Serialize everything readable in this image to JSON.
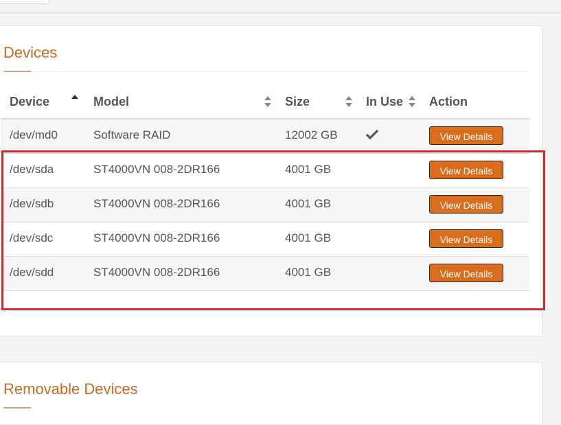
{
  "devices_panel": {
    "title": "Devices",
    "columns": {
      "device": "Device",
      "model": "Model",
      "size": "Size",
      "in_use": "In Use",
      "action": "Action"
    },
    "rows": [
      {
        "device": "/dev/md0",
        "model": "Software RAID",
        "size": "12002 GB",
        "in_use": true,
        "action": "View Details"
      },
      {
        "device": "/dev/sda",
        "model": "ST4000VN 008-2DR166",
        "size": "4001 GB",
        "in_use": false,
        "action": "View Details"
      },
      {
        "device": "/dev/sdb",
        "model": "ST4000VN 008-2DR166",
        "size": "4001 GB",
        "in_use": false,
        "action": "View Details"
      },
      {
        "device": "/dev/sdc",
        "model": "ST4000VN 008-2DR166",
        "size": "4001 GB",
        "in_use": false,
        "action": "View Details"
      },
      {
        "device": "/dev/sdd",
        "model": "ST4000VN 008-2DR166",
        "size": "4001 GB",
        "in_use": false,
        "action": "View Details"
      }
    ]
  },
  "removable_panel": {
    "title": "Removable Devices"
  },
  "colors": {
    "accent": "#c96a22",
    "button": "#d96d1e",
    "highlight": "#d12b2b"
  },
  "icons": {
    "sort_asc": "caret-up-icon",
    "sort_both": "sort-icon",
    "in_use": "check-icon"
  }
}
